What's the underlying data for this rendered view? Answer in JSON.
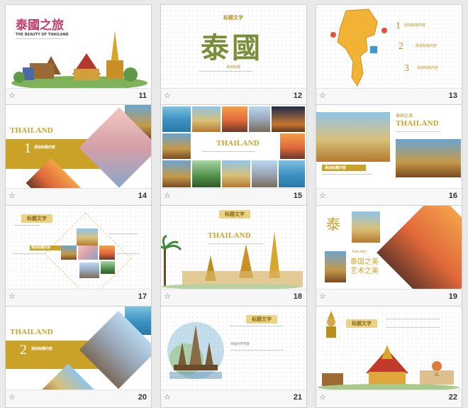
{
  "slides": [
    {
      "number": "11",
      "title": "泰國之旅",
      "subtitle": "THE BEAUTY OF THAILAND"
    },
    {
      "number": "12",
      "tag": "标题文字",
      "headline": "泰國",
      "small": "添加标题"
    },
    {
      "number": "13",
      "items": [
        {
          "index": "1",
          "label": "添加标题内容"
        },
        {
          "index": "2",
          "label": "添加标题内容"
        },
        {
          "index": "3",
          "label": "添加标题内容"
        }
      ]
    },
    {
      "number": "14",
      "heading": "THAILAND",
      "index": "1",
      "label": "添加标题内容"
    },
    {
      "number": "15",
      "heading": "THAILAND"
    },
    {
      "number": "16",
      "tag": "泰国之旅",
      "heading": "THAILAND",
      "label": "添加标题内容"
    },
    {
      "number": "17",
      "tag": "标题文字",
      "label": "添加标题内容"
    },
    {
      "number": "18",
      "tag": "标题文字",
      "heading": "THAILAND"
    },
    {
      "number": "19",
      "char": "泰",
      "small": "THAILAND",
      "line1": "泰国之美",
      "line2": "艺术之美"
    },
    {
      "number": "20",
      "heading": "THAILAND",
      "index": "2",
      "label": "添加标题内容"
    },
    {
      "number": "21",
      "tag": "标题文字",
      "label": "添加文字内容"
    },
    {
      "number": "22",
      "tag": "标题文字"
    }
  ],
  "icons": {
    "star": "star-icon"
  },
  "colors": {
    "gold": "#c9a227",
    "background": "#e9e9e9"
  }
}
